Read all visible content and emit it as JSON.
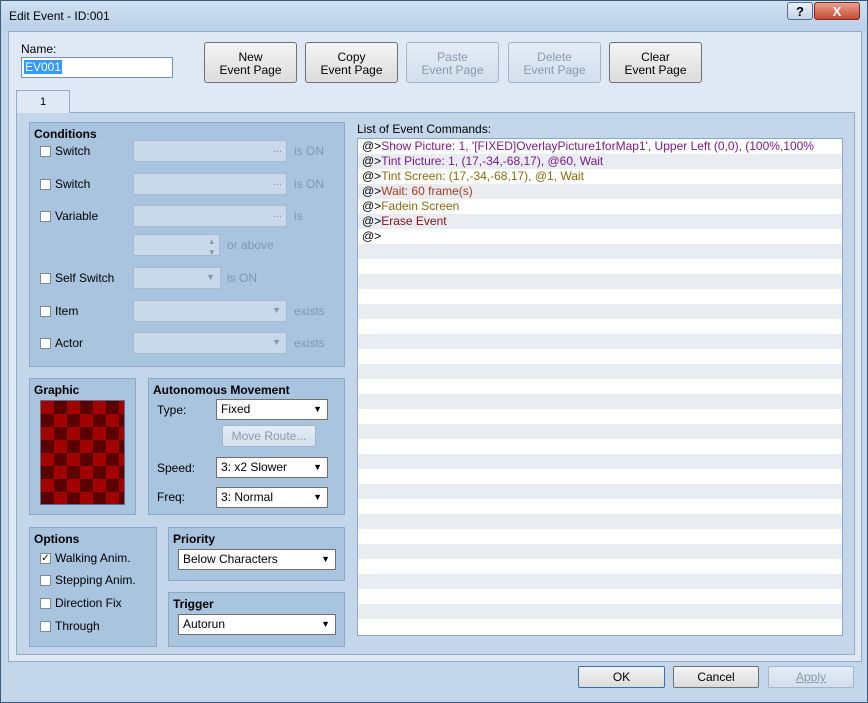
{
  "window": {
    "title": "Edit Event - ID:001",
    "help_label": "?",
    "close_label": "X"
  },
  "name": {
    "label": "Name:",
    "value": "EV001"
  },
  "page_buttons": [
    {
      "line1": "New",
      "line2": "Event Page",
      "enabled": true
    },
    {
      "line1": "Copy",
      "line2": "Event Page",
      "enabled": true
    },
    {
      "line1": "Paste",
      "line2": "Event Page",
      "enabled": false
    },
    {
      "line1": "Delete",
      "line2": "Event Page",
      "enabled": false
    },
    {
      "line1": "Clear",
      "line2": "Event Page",
      "enabled": true
    }
  ],
  "tabs": [
    "1"
  ],
  "conditions": {
    "title": "Conditions",
    "switch1": {
      "label": "Switch",
      "suffix": "is ON",
      "dots": "..."
    },
    "switch2": {
      "label": "Switch",
      "suffix": "is ON",
      "dots": "..."
    },
    "variable": {
      "label": "Variable",
      "suffix": "is",
      "dots": "...",
      "or_above": "or above"
    },
    "self_switch": {
      "label": "Self Switch",
      "suffix": "is ON"
    },
    "item": {
      "label": "Item",
      "suffix": "exists"
    },
    "actor": {
      "label": "Actor",
      "suffix": "exists"
    }
  },
  "graphic": {
    "title": "Graphic"
  },
  "autonomous": {
    "title": "Autonomous Movement",
    "type_label": "Type:",
    "type_value": "Fixed",
    "move_route_label": "Move Route...",
    "speed_label": "Speed:",
    "speed_value": "3: x2 Slower",
    "freq_label": "Freq:",
    "freq_value": "3: Normal"
  },
  "options": {
    "title": "Options",
    "items": [
      {
        "label": "Walking Anim.",
        "checked": true,
        "mark": "✓"
      },
      {
        "label": "Stepping Anim.",
        "checked": false,
        "mark": ""
      },
      {
        "label": "Direction Fix",
        "checked": false,
        "mark": ""
      },
      {
        "label": "Through",
        "checked": false,
        "mark": ""
      }
    ]
  },
  "priority": {
    "title": "Priority",
    "value": "Below Characters"
  },
  "trigger": {
    "title": "Trigger",
    "value": "Autorun"
  },
  "commands": {
    "title": "List of Event Commands:",
    "prefix": "@>",
    "items": [
      {
        "text": "Show Picture: 1, '[FIXED]OverlayPicture1forMap1', Upper Left (0,0), (100%,100%",
        "color": "#7a1a8a"
      },
      {
        "text": "Tint Picture: 1, (17,-34,-68,17), @60, Wait",
        "color": "#7a1a8a"
      },
      {
        "text": "Tint Screen: (17,-34,-68,17), @1, Wait",
        "color": "#8a6a10"
      },
      {
        "text": "Wait: 60 frame(s)",
        "color": "#b03a1a"
      },
      {
        "text": "Fadein Screen",
        "color": "#8a6a10"
      },
      {
        "text": "Erase Event",
        "color": "#8a1010"
      },
      {
        "text": "",
        "color": "#000000"
      }
    ]
  },
  "footer": {
    "ok": "OK",
    "cancel": "Cancel",
    "apply": "Apply"
  }
}
